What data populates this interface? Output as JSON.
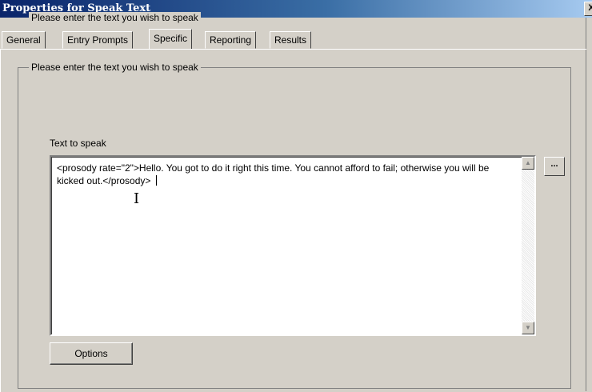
{
  "window": {
    "title": "Properties for Speak Text",
    "close_glyph": "X"
  },
  "tabs": [
    {
      "label": "General"
    },
    {
      "label": "Entry Prompts"
    },
    {
      "label": "Specific",
      "active": true
    },
    {
      "label": "Reporting"
    },
    {
      "label": "Results"
    }
  ],
  "group": {
    "legend": "Please enter the text you wish to speak"
  },
  "text_to_speak": {
    "label": "Text to speak",
    "value": "<prosody rate=\"2\">Hello. You got to do it right this time. You cannot afford to fail; otherwise you will be kicked out.</prosody> "
  },
  "buttons": {
    "ellipsis": "...",
    "options": "Options"
  },
  "icons": {
    "scroll_up": "up-arrow-icon",
    "scroll_down": "down-arrow-icon",
    "cursor": "text-cursor-icon"
  }
}
